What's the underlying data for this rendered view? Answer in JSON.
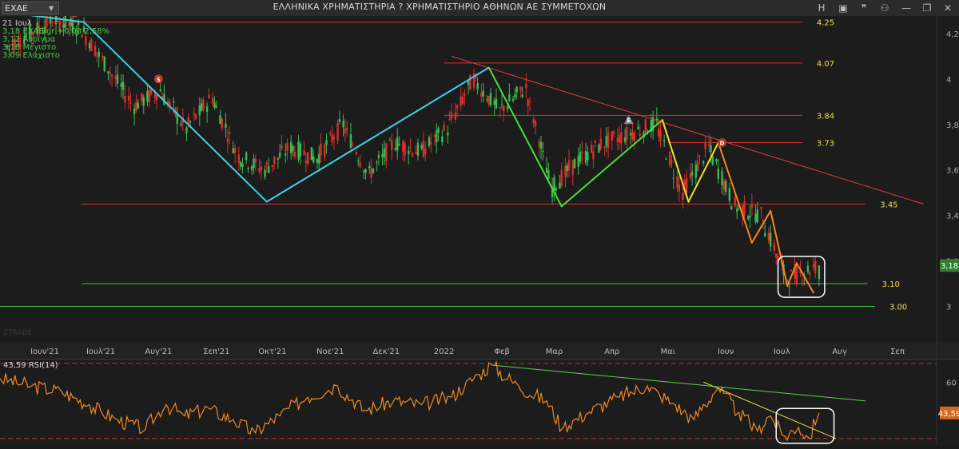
{
  "window": {
    "title": "ΕΛΛΗΝΙΚΑ ΧΡΗΜΑΤΙΣΤΗΡΙΑ ? ΧΡΗΜΑΤΙΣΤΗΡΙΟ ΑΘΗΝΩΝ ΑΕ ΣΥΜΜΕΤΟΧΩΝ",
    "symbol": "EXAE",
    "buttons": [
      {
        "name": "dropdown-icon",
        "glyph": "▾"
      },
      {
        "name": "h-button",
        "glyph": "H"
      },
      {
        "name": "image-icon",
        "glyph": "▣"
      },
      {
        "name": "quote-icon",
        "glyph": "❞"
      },
      {
        "name": "user-icon",
        "glyph": "⚇"
      },
      {
        "name": "minimize-icon",
        "glyph": "—"
      },
      {
        "name": "restore-icon",
        "glyph": "❐"
      },
      {
        "name": "close-icon",
        "glyph": "✕"
      }
    ]
  },
  "info": {
    "date": "21 Ιουλ",
    "last": "3,18 EXAE.gr +0,08 2,58%",
    "open": "3,12 Άνοιγμα",
    "high": "3,18 Μέγιστο",
    "low": "3,09 Ελάχιστο"
  },
  "colors": {
    "up": "#3fb950",
    "down": "#d9302c",
    "hline_red": "#d9302c",
    "hline_green": "#3fbf3f",
    "level_label": "#f0e040",
    "cyan": "#3fd0e8",
    "green_zz": "#46e03a",
    "yellow_zz": "#f2e22a",
    "orange_zz": "#f58a1f",
    "rsi": "#f08a24",
    "rsi_trend_green": "#5fd04f",
    "rsi_trend_yellow": "#e8e040",
    "box": "#ffffff"
  },
  "watermark": "ZTRADE",
  "markers": [
    {
      "label": "D",
      "shape": "circle",
      "color": "#b03a2e",
      "x": "2021-06-17",
      "y": 4.29
    },
    {
      "label": "S",
      "shape": "circle",
      "color": "#b03a2e",
      "x": "2021-08-01",
      "y": 4.0
    },
    {
      "label": "E",
      "shape": "triangle",
      "color": "#8a8a8a",
      "x": "2022-04-10",
      "y": 3.82
    },
    {
      "label": "D",
      "shape": "circle",
      "color": "#b03a2e",
      "x": "2022-05-30",
      "y": 3.72
    }
  ],
  "chart_data": [
    {
      "type": "candlestick",
      "x_axis": {
        "ticks": [
          "Ιουν'21",
          "Ιουλ'21",
          "Αυγ'21",
          "Σεπ'21",
          "Οκτ'21",
          "Νοε'21",
          "Δεκ'21",
          "2022",
          "Φεβ",
          "Μαρ",
          "Απρ",
          "Μαι",
          "Ιουν",
          "Ιουλ",
          "Αυγ",
          "Σεπ"
        ],
        "tick_dates": [
          "2021-06-01",
          "2021-07-01",
          "2021-08-01",
          "2021-09-01",
          "2021-10-01",
          "2021-11-01",
          "2021-12-01",
          "2022-01-01",
          "2022-02-01",
          "2022-03-01",
          "2022-04-01",
          "2022-05-01",
          "2022-06-01",
          "2022-07-01",
          "2022-08-01",
          "2022-09-01"
        ],
        "range": [
          "2021-05-08",
          "2022-09-22"
        ]
      },
      "y_axis": {
        "range": [
          2.97,
          4.27
        ],
        "ticks": [
          "3",
          "3,2",
          "3,4",
          "3,6",
          "3,8",
          "4",
          "4,2"
        ],
        "tick_values": [
          3.0,
          3.2,
          3.4,
          3.6,
          3.8,
          4.0,
          4.2
        ],
        "side": "right",
        "grid": false
      },
      "last_price_badge": "3,18",
      "last_price": 3.18,
      "zigzag_points": [
        {
          "x": "2021-05-15",
          "y": 4.29
        },
        {
          "x": "2021-06-22",
          "y": 4.25
        },
        {
          "x": "2021-09-28",
          "y": 3.46
        },
        {
          "x": "2022-01-25",
          "y": 4.05
        },
        {
          "x": "2022-03-05",
          "y": 3.44
        },
        {
          "x": "2022-04-28",
          "y": 3.82
        },
        {
          "x": "2022-05-12",
          "y": 3.46
        },
        {
          "x": "2022-05-28",
          "y": 3.72
        },
        {
          "x": "2022-06-15",
          "y": 3.28
        },
        {
          "x": "2022-06-25",
          "y": 3.42
        },
        {
          "x": "2022-07-04",
          "y": 3.09
        },
        {
          "x": "2022-07-09",
          "y": 3.19
        },
        {
          "x": "2022-07-18",
          "y": 3.06
        }
      ],
      "horizontal_levels": [
        {
          "value": 4.25,
          "label": "4.25",
          "color": "red",
          "from": "2021-05-31",
          "to": "2022-07-12"
        },
        {
          "value": 4.07,
          "label": "4.07",
          "color": "red",
          "from": "2022-01-01",
          "to": "2022-07-12"
        },
        {
          "value": 3.84,
          "label": "3.84",
          "color": "red",
          "from": "2022-01-01",
          "to": "2022-07-12"
        },
        {
          "value": 3.72,
          "label": "3.73",
          "color": "red",
          "from": "2022-05-01",
          "to": "2022-07-12"
        },
        {
          "value": 3.45,
          "label": "3.45",
          "color": "red",
          "from": "2021-06-21",
          "to": "2022-08-15"
        },
        {
          "value": 3.1,
          "label": "3.10",
          "color": "green",
          "from": "2021-06-21",
          "to": "2022-08-16"
        },
        {
          "value": 3.0,
          "label": "3.00",
          "color": "green",
          "from": "2021-05-08",
          "to": "2022-08-20"
        }
      ],
      "trendline": {
        "from": {
          "x": "2022-01-05",
          "y": 4.1
        },
        "to": {
          "x": "2022-09-15",
          "y": 3.45
        }
      },
      "highlight_box": {
        "from": "2022-06-29",
        "to": "2022-07-24",
        "y_from": 3.04,
        "y_to": 3.22
      },
      "candles": [
        {
          "x": "2021-05-12",
          "o": 4.12,
          "h": 4.19,
          "l": 4.06,
          "c": 4.14
        },
        {
          "x": "2021-05-24",
          "o": 4.18,
          "h": 4.25,
          "l": 4.12,
          "c": 4.2
        },
        {
          "x": "2021-06-07",
          "o": 4.24,
          "h": 4.3,
          "l": 4.18,
          "c": 4.26
        },
        {
          "x": "2021-06-21",
          "o": 4.27,
          "h": 4.3,
          "l": 4.19,
          "c": 4.22
        },
        {
          "x": "2021-07-05",
          "o": 4.13,
          "h": 4.18,
          "l": 4.02,
          "c": 4.05
        },
        {
          "x": "2021-07-19",
          "o": 3.96,
          "h": 4.04,
          "l": 3.85,
          "c": 3.88
        },
        {
          "x": "2021-08-02",
          "o": 3.85,
          "h": 3.99,
          "l": 3.8,
          "c": 3.95
        },
        {
          "x": "2021-08-16",
          "o": 3.9,
          "h": 3.95,
          "l": 3.74,
          "c": 3.78
        },
        {
          "x": "2021-08-30",
          "o": 3.82,
          "h": 3.98,
          "l": 3.78,
          "c": 3.92
        },
        {
          "x": "2021-09-13",
          "o": 3.78,
          "h": 3.86,
          "l": 3.62,
          "c": 3.66
        },
        {
          "x": "2021-09-27",
          "o": 3.56,
          "h": 3.64,
          "l": 3.46,
          "c": 3.6
        },
        {
          "x": "2021-10-11",
          "o": 3.62,
          "h": 3.74,
          "l": 3.55,
          "c": 3.7
        },
        {
          "x": "2021-10-25",
          "o": 3.7,
          "h": 3.82,
          "l": 3.62,
          "c": 3.65
        },
        {
          "x": "2021-11-08",
          "o": 3.72,
          "h": 3.92,
          "l": 3.68,
          "c": 3.8
        },
        {
          "x": "2021-11-22",
          "o": 3.62,
          "h": 3.72,
          "l": 3.52,
          "c": 3.58
        },
        {
          "x": "2021-12-06",
          "o": 3.68,
          "h": 3.78,
          "l": 3.6,
          "c": 3.72
        },
        {
          "x": "2021-12-20",
          "o": 3.7,
          "h": 3.76,
          "l": 3.6,
          "c": 3.68
        },
        {
          "x": "2022-01-03",
          "o": 3.72,
          "h": 3.82,
          "l": 3.66,
          "c": 3.78
        },
        {
          "x": "2022-01-17",
          "o": 3.86,
          "h": 4.06,
          "l": 3.82,
          "c": 4.0
        },
        {
          "x": "2022-01-31",
          "o": 3.96,
          "h": 4.04,
          "l": 3.8,
          "c": 3.86
        },
        {
          "x": "2022-02-14",
          "o": 3.86,
          "h": 4.04,
          "l": 3.82,
          "c": 3.96
        },
        {
          "x": "2022-02-28",
          "o": 3.74,
          "h": 3.82,
          "l": 3.46,
          "c": 3.52
        },
        {
          "x": "2022-03-14",
          "o": 3.56,
          "h": 3.68,
          "l": 3.52,
          "c": 3.64
        },
        {
          "x": "2022-03-28",
          "o": 3.66,
          "h": 3.76,
          "l": 3.6,
          "c": 3.72
        },
        {
          "x": "2022-04-11",
          "o": 3.72,
          "h": 3.8,
          "l": 3.66,
          "c": 3.76
        },
        {
          "x": "2022-04-25",
          "o": 3.76,
          "h": 3.83,
          "l": 3.7,
          "c": 3.8
        },
        {
          "x": "2022-05-09",
          "o": 3.6,
          "h": 3.66,
          "l": 3.46,
          "c": 3.5
        },
        {
          "x": "2022-05-23",
          "o": 3.56,
          "h": 3.74,
          "l": 3.54,
          "c": 3.7
        },
        {
          "x": "2022-06-06",
          "o": 3.58,
          "h": 3.62,
          "l": 3.4,
          "c": 3.44
        },
        {
          "x": "2022-06-20",
          "o": 3.3,
          "h": 3.44,
          "l": 3.26,
          "c": 3.4
        },
        {
          "x": "2022-07-04",
          "o": 3.18,
          "h": 3.22,
          "l": 3.08,
          "c": 3.12
        },
        {
          "x": "2022-07-21",
          "o": 3.12,
          "h": 3.18,
          "l": 3.09,
          "c": 3.18
        }
      ]
    },
    {
      "type": "line",
      "series": [
        {
          "name": "RSI(14)",
          "points": [
            {
              "x": "2021-05-08",
              "y": 62
            },
            {
              "x": "2021-05-25",
              "y": 58
            },
            {
              "x": "2021-06-10",
              "y": 55
            },
            {
              "x": "2021-06-25",
              "y": 48
            },
            {
              "x": "2021-07-10",
              "y": 40
            },
            {
              "x": "2021-07-25",
              "y": 35
            },
            {
              "x": "2021-08-05",
              "y": 48
            },
            {
              "x": "2021-08-15",
              "y": 42
            },
            {
              "x": "2021-08-28",
              "y": 46
            },
            {
              "x": "2021-09-10",
              "y": 40
            },
            {
              "x": "2021-09-22",
              "y": 33
            },
            {
              "x": "2021-10-05",
              "y": 42
            },
            {
              "x": "2021-10-20",
              "y": 52
            },
            {
              "x": "2021-11-05",
              "y": 58
            },
            {
              "x": "2021-11-20",
              "y": 45
            },
            {
              "x": "2021-12-05",
              "y": 50
            },
            {
              "x": "2021-12-20",
              "y": 48
            },
            {
              "x": "2022-01-05",
              "y": 52
            },
            {
              "x": "2022-01-20",
              "y": 64
            },
            {
              "x": "2022-01-27",
              "y": 69
            },
            {
              "x": "2022-02-10",
              "y": 58
            },
            {
              "x": "2022-02-25",
              "y": 50
            },
            {
              "x": "2022-03-06",
              "y": 36
            },
            {
              "x": "2022-03-20",
              "y": 44
            },
            {
              "x": "2022-04-05",
              "y": 52
            },
            {
              "x": "2022-04-20",
              "y": 58
            },
            {
              "x": "2022-05-05",
              "y": 48
            },
            {
              "x": "2022-05-15",
              "y": 40
            },
            {
              "x": "2022-05-28",
              "y": 57
            },
            {
              "x": "2022-06-08",
              "y": 44
            },
            {
              "x": "2022-06-18",
              "y": 34
            },
            {
              "x": "2022-06-25",
              "y": 42
            },
            {
              "x": "2022-07-03",
              "y": 31
            },
            {
              "x": "2022-07-10",
              "y": 36
            },
            {
              "x": "2022-07-16",
              "y": 30
            },
            {
              "x": "2022-07-21",
              "y": 43.59
            }
          ]
        }
      ],
      "label": "43,59 RSI(14)",
      "value_badge": "43,59",
      "y_axis": {
        "range": [
          27,
          72
        ],
        "ticks": [
          "60"
        ],
        "tick_values": [
          60
        ]
      },
      "reference_lines": [
        70,
        30
      ],
      "trendlines": [
        {
          "color": "green",
          "from": {
            "x": "2022-01-27",
            "y": 69
          },
          "to": {
            "x": "2022-08-15",
            "y": 50
          }
        },
        {
          "color": "yellow",
          "from": {
            "x": "2022-05-20",
            "y": 60
          },
          "to": {
            "x": "2022-07-30",
            "y": 30
          }
        }
      ],
      "highlight_box": {
        "from": "2022-06-28",
        "to": "2022-07-29",
        "y_from": 27.5,
        "y_to": 46
      }
    }
  ]
}
